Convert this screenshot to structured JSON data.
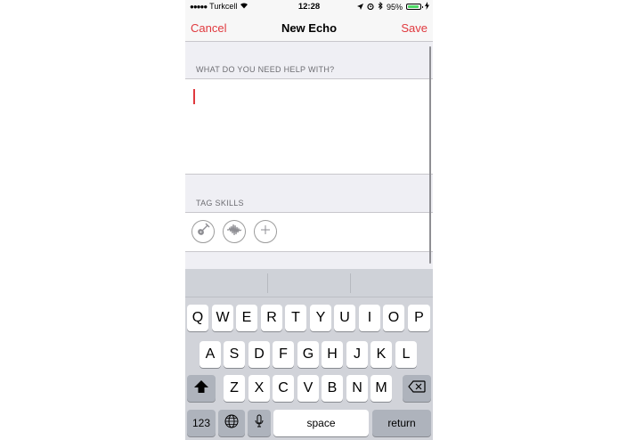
{
  "status_bar": {
    "signal": "●●●●●",
    "carrier": "Turkcell",
    "time": "12:28",
    "battery": "95%",
    "battery_level": 0.95
  },
  "nav": {
    "cancel_label": "Cancel",
    "title": "New Echo",
    "save_label": "Save"
  },
  "help_section": {
    "header": "WHAT DO YOU NEED HELP WITH?",
    "value": ""
  },
  "skills_section": {
    "header": "TAG SKILLS",
    "skills": [
      {
        "icon": "guitar-icon"
      },
      {
        "icon": "waveform-icon"
      },
      {
        "icon": "plus-icon"
      }
    ]
  },
  "keyboard": {
    "row1": [
      "Q",
      "W",
      "E",
      "R",
      "T",
      "Y",
      "U",
      "I",
      "O",
      "P"
    ],
    "row2": [
      "A",
      "S",
      "D",
      "F",
      "G",
      "H",
      "J",
      "K",
      "L"
    ],
    "row3": [
      "Z",
      "X",
      "C",
      "V",
      "B",
      "N",
      "M"
    ],
    "numbers_label": "123",
    "space_label": "space",
    "return_label": "return"
  },
  "colors": {
    "accent": "#e0393e",
    "battery": "#4cd964"
  }
}
